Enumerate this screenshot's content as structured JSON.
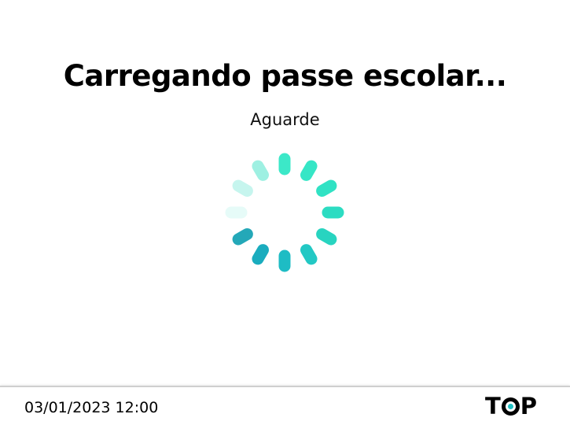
{
  "loading": {
    "title": "Carregando passe escolar...",
    "subtitle": "Aguarde"
  },
  "spinner": {
    "icon": "loading-spinner-icon",
    "segment_colors": [
      "#3ce8c8",
      "#36e6c6",
      "#30e2c4",
      "#2cdcc2",
      "#28d4c0",
      "#22c8c4",
      "#1ebcc4",
      "#1aacbe",
      "#24a8b8",
      "#e6fbf8",
      "#c6f5ee",
      "#9ef0e2"
    ],
    "accent": "#1fbfc2"
  },
  "footer": {
    "datetime": "03/01/2023 12:00",
    "logo": {
      "letter_left": "T",
      "letter_right": "P",
      "dot_color": "#1fbfc2"
    }
  }
}
